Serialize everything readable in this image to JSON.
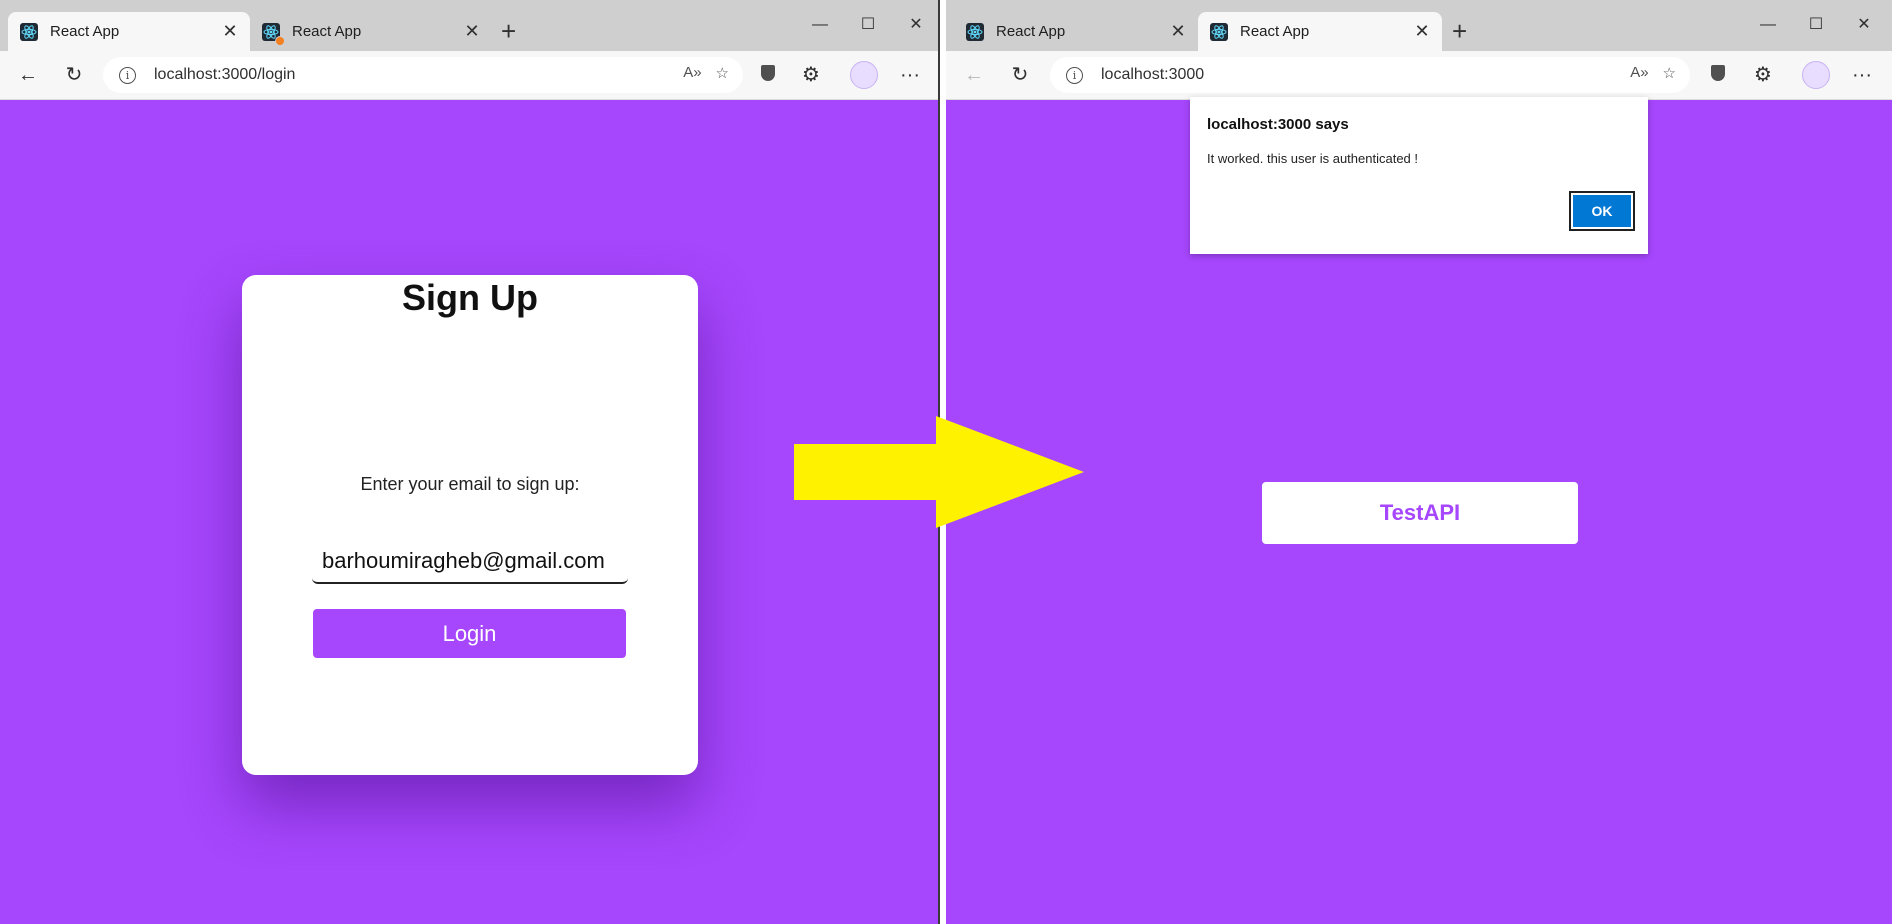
{
  "colors": {
    "page_purple": "#a646fd",
    "arrow_yellow": "#fff200",
    "ok_blue": "#0078d4"
  },
  "left_window": {
    "tabs": [
      {
        "label": "React App",
        "icon": "react-icon",
        "active": true
      },
      {
        "label": "React App",
        "icon": "react-icon",
        "active": false,
        "badge": "orange-dot"
      }
    ],
    "url": "localhost:3000/login",
    "card": {
      "title": "Sign Up",
      "prompt": "Enter your email to sign up:",
      "email_value": "barhoumiragheb@gmail.com",
      "login_label": "Login"
    }
  },
  "right_window": {
    "tabs": [
      {
        "label": "React App",
        "icon": "react-icon",
        "active": false
      },
      {
        "label": "React App",
        "icon": "react-icon",
        "active": true
      }
    ],
    "url": "localhost:3000",
    "dialog": {
      "title": "localhost:3000 says",
      "message": "It worked. this user is authenticated !",
      "ok_label": "OK"
    },
    "testapi_label": "TestAPI"
  },
  "icons": {
    "new_tab": "+",
    "tab_close": "✕",
    "minimize": "—",
    "maximize": "☐",
    "close": "✕",
    "back": "←",
    "reload": "↻",
    "more": "···",
    "read_aloud": "A»",
    "favorites": "☆",
    "extensions": "⚙"
  }
}
